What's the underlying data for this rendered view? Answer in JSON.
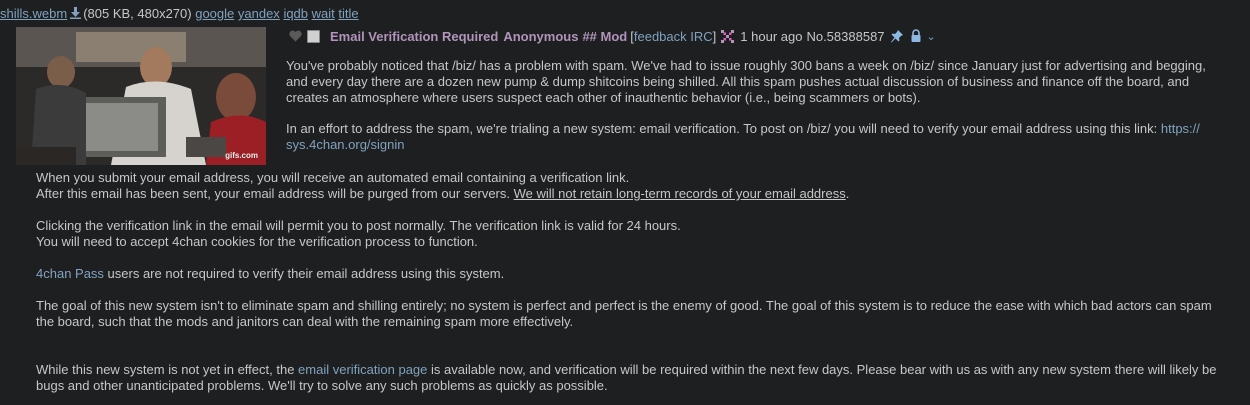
{
  "file": {
    "name": "shills.webm",
    "info": "(805 KB, 480x270)",
    "search_links": [
      "google",
      "yandex",
      "iqdb",
      "wait",
      "title"
    ],
    "watermark": "gifs.com"
  },
  "post": {
    "subject": "Email Verification Required",
    "name": "Anonymous",
    "capcode": "## Mod",
    "feedback_open": "[",
    "feedback_label": "feedback",
    "irc_label": "IRC",
    "feedback_close": "]",
    "time": "1 hour ago",
    "post_no": "No.58388587"
  },
  "body": {
    "p1": "You've probably noticed that /biz/ has a problem with spam. We've had to issue roughly 300 bans a week on /biz/ since January just for advertising and begging, and every day there are a dozen new pump & dump shitcoins being shilled. All this spam pushes actual discussion of business and finance off the board, and creates an atmosphere where users suspect each other of inauthentic behavior (i.e., being scammers or bots).",
    "p2_text": "In an effort to address the spam, we're trialing a new system: email verification. To post on /biz/ you will need to verify your email address using this link: ",
    "p2_link": "https:// sys.4chan.org/signin",
    "p3_line1": "When you submit your email address, you will receive an automated email containing a verification link.",
    "p3_line2a": "After this email has been sent, your email address will be purged from our servers. ",
    "p3_line2u": "We will not retain long-term records of your email address",
    "p3_line2end": ".",
    "p4_line1": "Clicking the verification link in the email will permit you to post normally. The verification link is valid for 24 hours.",
    "p4_line2": "You will need to accept 4chan cookies for the verification process to function.",
    "p5_link": "4chan Pass",
    "p5_text": " users are not required to verify their email address using this system.",
    "p6": "The goal of this new system isn't to eliminate spam and shilling entirely; no system is perfect and perfect is the enemy of good. The goal of this system is to reduce the ease with which bad actors can spam the board, such that the mods and janitors can deal with the remaining spam more effectively.",
    "p7_a": "While this new system is not yet in effect, the ",
    "p7_link": "email verification page",
    "p7_b": " is available now, and verification will be required within the next few days. Please bear with us as with any new system there will likely be bugs and other unanticipated problems. We'll try to solve any such problems as quickly as possible."
  },
  "colors": {
    "background": "#1d1f21",
    "text": "#c5c8c6",
    "link": "#81a2be",
    "name": "#b294bb"
  }
}
